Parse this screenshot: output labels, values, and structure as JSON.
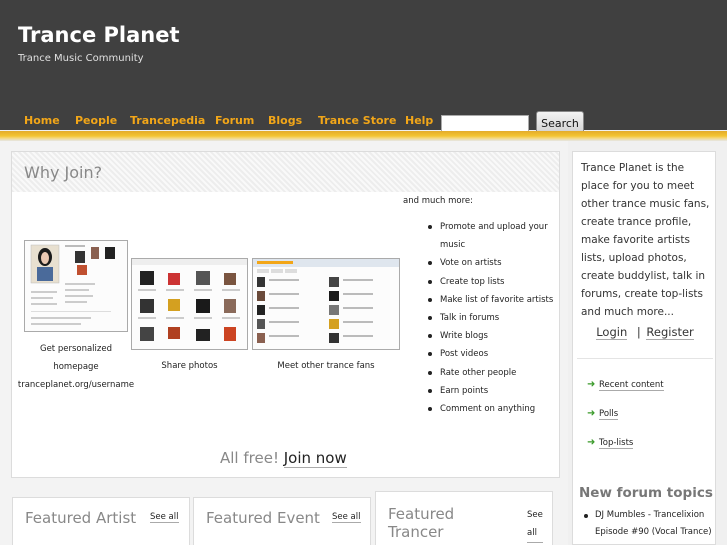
{
  "header": {
    "site_title": "Trance Planet",
    "slogan": "Trance Music Community"
  },
  "nav": {
    "items": [
      "Home",
      "People",
      "Trancepedia",
      "Forum",
      "Blogs",
      "Trance Store",
      "Help"
    ],
    "search_button": "Search",
    "search_value": ""
  },
  "why_join": {
    "title": "Why Join?",
    "captions": {
      "homepage": [
        "Get personalized",
        "homepage",
        "tranceplanet.org/username"
      ],
      "photos": "Share photos",
      "fans": "Meet other trance fans"
    },
    "much_more": "and much more:",
    "features": [
      "Promote and upload your music",
      "Vote on artists",
      "Create top lists",
      "Make list of favorite artists",
      "Talk in forums",
      "Write blogs",
      "Post videos",
      "Rate other people",
      "Earn points",
      "Comment on anything"
    ],
    "all_free": "All free!",
    "join_now": "Join now"
  },
  "featured": {
    "artist": {
      "title": "Featured Artist",
      "see_all": "See all"
    },
    "event": {
      "title": "Featured Event",
      "see_all": "See all"
    },
    "trancer": {
      "title_line1": "Featured",
      "title_line2": "Trancer",
      "see_line1": "See",
      "see_line2": "all"
    }
  },
  "sidebar": {
    "intro": "Trance Planet is the place for you to meet other trance music fans, create trance profile, make favorite artists lists, upload photos, create buddylist, talk in forums, create top-lists and much more...",
    "login": "Login",
    "separator": "|",
    "register": "Register",
    "links": [
      "Recent content",
      "Polls",
      "Top-lists"
    ],
    "forum_title": "New forum topics",
    "forum_topics": [
      "DJ Mumbles - Trancelixion Episode #90 (Vocal Trance)"
    ]
  },
  "colors": {
    "header_bg": "#404040",
    "nav_link": "#f2a618",
    "stripe": "#f4c533",
    "arrow": "#3a9a2a"
  }
}
